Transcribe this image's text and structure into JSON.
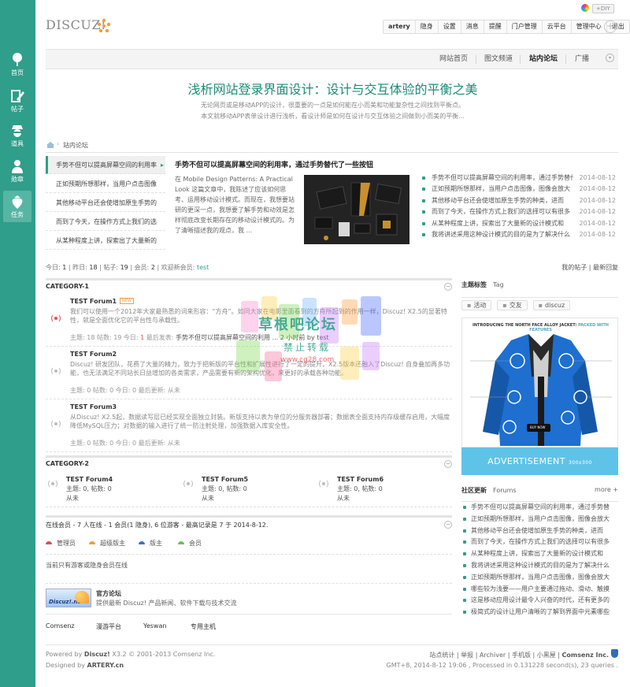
{
  "sidebar": {
    "items": [
      {
        "label": "首页",
        "icon": "tree-icon"
      },
      {
        "label": "帖子",
        "icon": "pencil-icon"
      },
      {
        "label": "道具",
        "icon": "spy-icon"
      },
      {
        "label": "勋章",
        "icon": "user-icon"
      },
      {
        "label": "任务",
        "icon": "strawberry-icon"
      }
    ]
  },
  "header": {
    "logo": "DISCUZ!",
    "diy": "+DIY",
    "user": "artery",
    "toplinks": [
      "隐身",
      "设置",
      "消息",
      "提醒",
      "门户管理",
      "云平台",
      "管理中心",
      "退出"
    ]
  },
  "nav": {
    "items": [
      "网站首页",
      "图文频道",
      "站内论坛",
      "广播"
    ],
    "active": "站内论坛"
  },
  "banner": {
    "title": "浅析网站登录界面设计：设计与交互体验的平衡之美",
    "desc1": "无论网页或是移动APP的设计，很重要的一点是如何能在小而美和功能复杂性之间找到平衡点。",
    "desc2": "本文就移动APP表单设计进行浅析，看设计师是如何在设计与交互体验之间做到小而美的平衡..."
  },
  "breadcrumb": {
    "sep": "›",
    "current": "站内论坛"
  },
  "slide": {
    "tabs": [
      "手势不但可以提高屏幕空间的利用率",
      "正如预期所想那样，当用户点击图像",
      "其他移动平台还会使增加原生手势的",
      "而到了今天，在操作方式上我们的选",
      "从某种程度上讲，探索出了大量新的"
    ],
    "active_arrow": "▸",
    "title": "手势不但可以提高屏幕空间的利用率，通过手势替代了一些按钮",
    "text": "在 Mobile Design Patterns: A Practical Look 这篇文章中，我陈述了应该如何思考、运用移动设计模式。而现在，我想要站研的更深一点，我想要了解手势和动效是怎样彻底改变长期存在的移动设计模式的。为了清晰描述我的观点，我 ..."
  },
  "news": [
    {
      "title": "手势不但可以提高屏幕空间的利用率，通过手势替代",
      "date": "2014-08-12"
    },
    {
      "title": "正如预期所想那样，当用户点击图像，图像会放大",
      "date": "2014-08-12"
    },
    {
      "title": "其他移动平台还会使增加原生手势的种类，进而",
      "date": "2014-08-12"
    },
    {
      "title": "而到了今天，在操作方式上我们的选择可以有很多",
      "date": "2014-08-12"
    },
    {
      "title": "从某种程度上讲，探索出了大量新的设计模式和",
      "date": "2014-08-12"
    },
    {
      "title": "我将讲述采用这种设计模式的目的是为了解决什么",
      "date": "2014-08-12"
    }
  ],
  "stats": {
    "today_label": "今日:",
    "today": "1",
    "yesterday_label": "昨日:",
    "yesterday": "18",
    "posts_label": "帖子:",
    "posts": "19",
    "members_label": "会员:",
    "members": "2",
    "welcome_label": "欢迎新会员:",
    "newest": "test",
    "my_posts": "我的帖子",
    "latest": "最新回复"
  },
  "cat1": {
    "title": "CATEGORY-1",
    "toggle": "−"
  },
  "forums": [
    {
      "name": "TEST Forum1",
      "new_badge": "NEW",
      "desc": "我们可以使用一个2012年大家最熟悉的词来形容：“方舟”。如同大家在电影里面看到的方舟所起到的作用一样，Discuz! X2.5的显著特性，就是全面优化它的平台性与承载性。",
      "stat": "主题: 18    帖数: 19    今日: ",
      "today": "1",
      "last_label": "    最后发表: ",
      "last": "手势不但可以提高屏幕空间的利用 ... 2 小时前  by test"
    },
    {
      "name": "TEST Forum2",
      "desc": "Discuz! 研发团队，花费了大量的精力，致力于把新版的平台性和扩展性进行了一定的提升，X2.5版本还融入了Discuz! 自身叠加再多功能，也无法满足不同站长日益增加的各类需求，产品需要有新的架构优化，来更好的承载各种功能。",
      "stat": "主题: 0    帖数: 0    今日: 0    最后更新: ",
      "last": "从未"
    },
    {
      "name": "TEST Forum3",
      "desc": "从Discuz! X2.5起，数据读写层已经实现全面独立封装。新版支持以表为单位的分服务器部署；数据表全面支持内存级缓存启用，大幅度降低MySQL压力；对数据的输入进行了统一防注射处理，加强数据入库安全性。",
      "stat": "主题: 0    帖数: 0    今日: 0    最后更新: ",
      "last": "从未"
    }
  ],
  "cat2": {
    "title": "CATEGORY-2",
    "toggle": "−",
    "forums": [
      {
        "name": "TEST Forum4",
        "stat": "主题: 0, 帖数: 0",
        "last": "从未"
      },
      {
        "name": "TEST Forum5",
        "stat": "主题: 0, 帖数: 0",
        "last": "从未"
      },
      {
        "name": "TEST Forum6",
        "stat": "主题: 0, 帖数: 0",
        "last": "从未"
      }
    ]
  },
  "online": {
    "text": "在线会员 - 7 人在线 - 1 会员(1 隐身), 6 位游客 - 最高记录是 7 于 2014-8-12.",
    "toggle": "−",
    "legend": [
      {
        "label": "管理员",
        "color": "#d9534f"
      },
      {
        "label": "超级版主",
        "color": "#f29d3a"
      },
      {
        "label": "版主",
        "color": "#3b73c9"
      },
      {
        "label": "会员",
        "color": "#6cbf5a"
      }
    ],
    "note": "当前只有游客或隐身会员在线"
  },
  "links": {
    "logo": "Discuz!.net",
    "title": "官方论坛",
    "desc": "提供最新 Discuz! 产品新闻、软件下载与技术交流"
  },
  "partners": [
    "Comsenz",
    "漫游平台",
    "Yeswan",
    "专用主机"
  ],
  "right": {
    "tags_title": "主题标签",
    "tags_sub": "Tag",
    "tags": [
      "活动",
      "交友",
      "discuz"
    ],
    "tag_prefix": "▪",
    "ad_head": "INTRODUCING THE NORTH FACE ALLOY JACKET:",
    "ad_head_accent": " PACKED WITH FEATURES",
    "ad_buy": "BUY NOW",
    "ad_text": "ADVERTISEMENT",
    "ad_size": "300x300",
    "community_title": "社区更新",
    "community_sub": "Forums",
    "more": "more +",
    "community": [
      "手势不但可以提高屏幕空间的利用率，通过手势替",
      "正如预期所想那样，当用户点击图像，图像会放大",
      "其他移动平台还会使增加原生手势的种类，进而",
      "而到了今天，在操作方式上我们的选择可以有很多",
      "从某种程度上讲，探索出了大量新的设计模式和",
      "我将讲述采用这种设计模式的目的是为了解决什么",
      "正如预期所想那样，当用户点击图像，图像会放大",
      "哪些较为浅要——用户主要通过拖动、滑动、触摸",
      "这是移动应用设计最令人兴奋的时代，还有更多的",
      "极简式的设计让用户清晰的了解到界面中元素哪些"
    ]
  },
  "footer": {
    "powered": "Powered by ",
    "brand": "Discuz!",
    "version": " X3.2 © 2001-2013 Comsenz Inc.",
    "designed": "Designed by ",
    "designer": "ARTERY.cn",
    "links": "站点统计 | 举报 | Archiver | 手机版 | 小黑屋 | ",
    "company": "Comsenz Inc.",
    "runtime": "GMT+8, 2014-8-12 19:06 , Processed in 0.131228 second(s), 23 queries ."
  },
  "watermark": {
    "line1": "草根吧论坛",
    "line2": "禁止转载",
    "line3": "www.cg28.com"
  }
}
